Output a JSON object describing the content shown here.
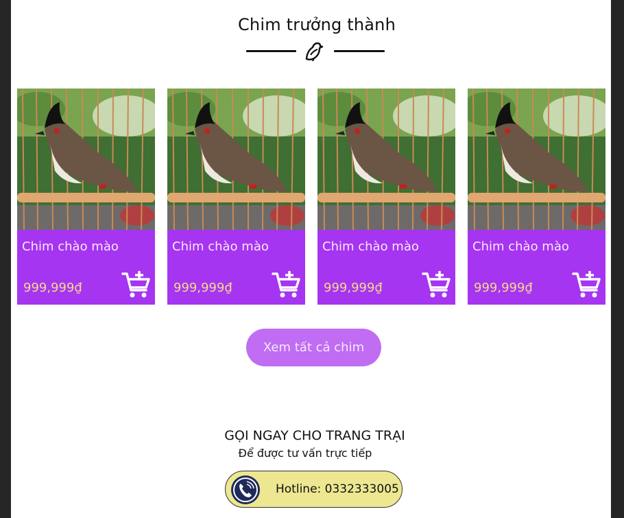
{
  "section": {
    "title": "Chim trưởng thành"
  },
  "products": [
    {
      "name": "Chim chào mào",
      "price": "999,999₫"
    },
    {
      "name": "Chim chào mào",
      "price": "999,999₫"
    },
    {
      "name": "Chim chào mào",
      "price": "999,999₫"
    },
    {
      "name": "Chim chào mào",
      "price": "999,999₫"
    }
  ],
  "view_all_label": "Xem tất cả chim",
  "contact": {
    "title": "GỌI NGAY CHO TRANG TRẠI",
    "subtitle": "Để được tư vấn trực tiếp",
    "hotline": "Hotline: 0332333005"
  },
  "colors": {
    "card_bg": "#a535f0",
    "price": "#f6d98a",
    "button_bg": "#c06cf3",
    "hotline_bg": "#ece790"
  },
  "icons": [
    "bird-icon",
    "add-to-cart-icon",
    "phone-icon"
  ]
}
